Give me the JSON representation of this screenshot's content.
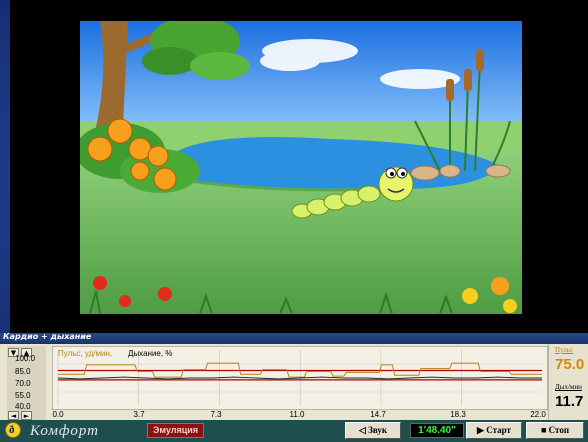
{
  "panel": {
    "title": "Кардио + дыхание"
  },
  "chart": {
    "legend_pulse": "Пульс, уд/мин,",
    "legend_breath": "Дыхание, %",
    "y_ticks": [
      "100.0",
      "85.0",
      "70.0",
      "55.0",
      "40.0"
    ],
    "x_ticks": [
      "0.0",
      "3.7",
      "7.3",
      "11.0",
      "14.7",
      "18.3",
      "22.0"
    ],
    "colors": {
      "pulse": "#b8860b",
      "breath": "#222222",
      "threshold": "#b00000"
    }
  },
  "chart_data": {
    "type": "line",
    "xlim": [
      0,
      22
    ],
    "ylim": [
      40,
      100
    ],
    "series": [
      {
        "name": "Пульс, уд/мин,",
        "x": [
          0,
          1.2,
          1.3,
          3.5,
          3.6,
          4.3,
          4.4,
          5.6,
          5.7,
          6.7,
          6.8,
          8.2,
          8.3,
          9.2,
          9.3,
          10.4,
          10.5,
          11.2,
          11.3,
          12.4,
          12.5,
          13.0,
          13.1,
          14.6,
          14.7,
          15.2,
          15.3,
          16.4,
          16.5,
          17.8,
          17.9,
          19.1,
          19.2,
          20.5,
          20.6,
          22.0
        ],
        "y": [
          74,
          74,
          84,
          84,
          77,
          77,
          71,
          71,
          79,
          79,
          86,
          86,
          74,
          74,
          79,
          79,
          71,
          71,
          77,
          77,
          72,
          72,
          76,
          76,
          84,
          84,
          73,
          73,
          80,
          80,
          86,
          86,
          77,
          77,
          74,
          74
        ]
      },
      {
        "name": "Дыхание, %",
        "x": [
          0,
          1,
          2,
          3,
          4,
          5,
          6,
          7,
          8,
          9,
          10,
          11,
          12,
          13,
          14,
          15,
          16,
          17,
          18,
          19,
          20,
          21,
          22
        ],
        "y": [
          70,
          69,
          70,
          71,
          70,
          69,
          70,
          70,
          71,
          70,
          69,
          70,
          71,
          70,
          70,
          69,
          70,
          71,
          70,
          70,
          71,
          70,
          70
        ]
      }
    ],
    "thresholds": [
      78,
      68
    ]
  },
  "right": {
    "pulse_label": "Пульс",
    "pulse_value": "75.0",
    "breath_label": "Дых/мин",
    "breath_value": "11.7"
  },
  "bottom": {
    "logo_glyph": "ð",
    "brand": "Комфорт",
    "emulation": "Эмуляция",
    "sound": "Звук",
    "timer": "1'48.40\"",
    "start": "Старт",
    "stop": "Стоп"
  }
}
